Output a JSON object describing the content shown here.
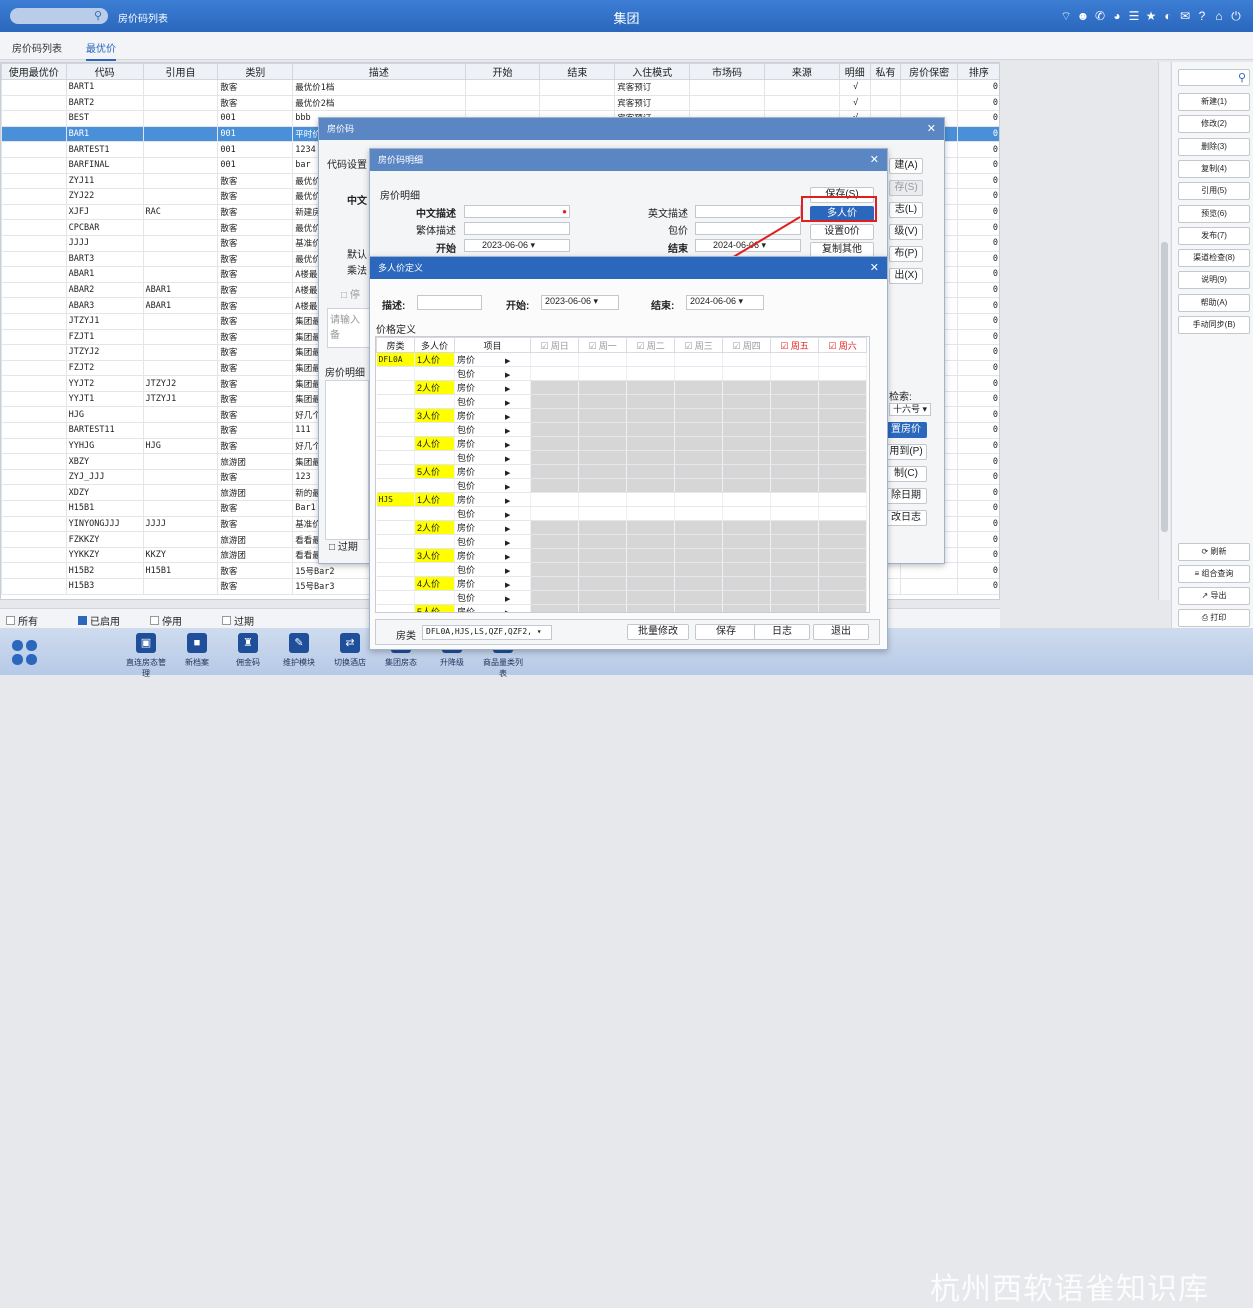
{
  "topbar": {
    "tab_title": "房价码列表",
    "center_title": "集团",
    "icons": [
      "wifi-icon",
      "face-icon",
      "phone-icon",
      "palette-icon",
      "list-icon",
      "star-icon",
      "moon-icon",
      "mail-icon",
      "help-icon",
      "home-icon",
      "power-icon"
    ]
  },
  "tabs": [
    "房价码列表",
    "最优价"
  ],
  "grid": {
    "headers": [
      "使用最优价",
      "代码",
      "引用自",
      "类别",
      "描述",
      "开始",
      "结束",
      "入住模式",
      "市场码",
      "来源",
      "明细",
      "私有",
      "房价保密",
      "排序"
    ],
    "rows": [
      [
        "",
        "BART1",
        "",
        "散客",
        "最优价1档",
        "",
        "",
        "宾客预订",
        "",
        "",
        "√",
        "",
        "",
        "0"
      ],
      [
        "",
        "BART2",
        "",
        "散客",
        "最优价2档",
        "",
        "",
        "宾客预订",
        "",
        "",
        "√",
        "",
        "",
        "0"
      ],
      [
        "",
        "BEST",
        "",
        "001",
        "bbb",
        "",
        "",
        "宾客预订",
        "",
        "",
        "√",
        "",
        "",
        "0"
      ],
      [
        "",
        "BAR1",
        "",
        "001",
        "平时价",
        "",
        "",
        "",
        "",
        "",
        "",
        "",
        "",
        "0"
      ],
      [
        "",
        "BARTEST1",
        "",
        "001",
        "1234",
        "",
        "",
        "",
        "",
        "",
        "",
        "",
        "",
        "0"
      ],
      [
        "",
        "BARFINAL",
        "",
        "001",
        "bar",
        "",
        "",
        "",
        "",
        "",
        "",
        "",
        "",
        "0"
      ],
      [
        "",
        "ZYJ11",
        "",
        "散客",
        "最优价",
        "",
        "",
        "",
        "",
        "",
        "",
        "",
        "",
        "0"
      ],
      [
        "",
        "ZYJ22",
        "",
        "散客",
        "最优价",
        "",
        "",
        "",
        "",
        "",
        "",
        "",
        "",
        "0"
      ],
      [
        "",
        "XJFJ",
        "RAC",
        "散客",
        "新建房",
        "",
        "",
        "",
        "",
        "",
        "",
        "",
        "",
        "0"
      ],
      [
        "",
        "CPCBAR",
        "",
        "散客",
        "最优价",
        "",
        "",
        "",
        "",
        "",
        "",
        "",
        "",
        "0"
      ],
      [
        "",
        "JJJJ",
        "",
        "散客",
        "基准价",
        "",
        "",
        "",
        "",
        "",
        "",
        "",
        "",
        "0"
      ],
      [
        "",
        "BART3",
        "",
        "散客",
        "最优价",
        "",
        "",
        "",
        "",
        "",
        "",
        "",
        "",
        "0"
      ],
      [
        "",
        "ABAR1",
        "",
        "散客",
        "A楼最",
        "",
        "",
        "",
        "",
        "",
        "",
        "",
        "",
        "0"
      ],
      [
        "",
        "ABAR2",
        "ABAR1",
        "散客",
        "A楼最",
        "",
        "",
        "",
        "",
        "",
        "",
        "",
        "",
        "0"
      ],
      [
        "",
        "ABAR3",
        "ABAR1",
        "散客",
        "A楼最",
        "",
        "",
        "",
        "",
        "",
        "",
        "",
        "",
        "0"
      ],
      [
        "",
        "JTZYJ1",
        "",
        "散客",
        "集团最",
        "",
        "",
        "",
        "",
        "",
        "",
        "",
        "",
        "0"
      ],
      [
        "",
        "FZJT1",
        "",
        "散客",
        "集团最",
        "",
        "",
        "",
        "",
        "",
        "",
        "",
        "",
        "0"
      ],
      [
        "",
        "JTZYJ2",
        "",
        "散客",
        "集团最",
        "",
        "",
        "",
        "",
        "",
        "",
        "",
        "",
        "0"
      ],
      [
        "",
        "FZJT2",
        "",
        "散客",
        "集团最",
        "",
        "",
        "",
        "",
        "",
        "",
        "",
        "",
        "0"
      ],
      [
        "",
        "YYJT2",
        "JTZYJ2",
        "散客",
        "集团最",
        "",
        "",
        "",
        "",
        "",
        "",
        "",
        "",
        "0"
      ],
      [
        "",
        "YYJT1",
        "JTZYJ1",
        "散客",
        "集团最",
        "",
        "",
        "",
        "",
        "",
        "",
        "",
        "",
        "0"
      ],
      [
        "",
        "HJG",
        "",
        "散客",
        "好几个",
        "",
        "",
        "",
        "",
        "",
        "",
        "",
        "",
        "0"
      ],
      [
        "",
        "BARTEST11",
        "",
        "散客",
        "111",
        "",
        "",
        "",
        "",
        "",
        "",
        "",
        "",
        "0"
      ],
      [
        "",
        "YYHJG",
        "HJG",
        "散客",
        "好几个",
        "",
        "",
        "",
        "",
        "",
        "",
        "",
        "",
        "0"
      ],
      [
        "",
        "XBZY",
        "",
        "旅游团",
        "集团最",
        "",
        "",
        "",
        "",
        "",
        "",
        "",
        "",
        "0"
      ],
      [
        "",
        "ZYJ_JJJ",
        "",
        "散客",
        "123",
        "",
        "",
        "",
        "",
        "",
        "",
        "",
        "",
        "0"
      ],
      [
        "",
        "XDZY",
        "",
        "旅游团",
        "新的最",
        "",
        "",
        "",
        "",
        "",
        "",
        "",
        "",
        "0"
      ],
      [
        "",
        "H15B1",
        "",
        "散客",
        "Bar1",
        "",
        "",
        "",
        "",
        "",
        "",
        "",
        "",
        "0"
      ],
      [
        "",
        "YINYONGJJJ",
        "JJJJ",
        "散客",
        "基准价",
        "",
        "",
        "",
        "",
        "",
        "",
        "",
        "",
        "0"
      ],
      [
        "",
        "FZKKZY",
        "",
        "旅游团",
        "看看最",
        "",
        "",
        "",
        "",
        "",
        "",
        "",
        "",
        "0"
      ],
      [
        "",
        "YYKKZY",
        "KKZY",
        "旅游团",
        "看看最",
        "",
        "",
        "",
        "",
        "",
        "",
        "",
        "",
        "0"
      ],
      [
        "",
        "H15B2",
        "H15B1",
        "散客",
        "15号Bar2",
        "",
        "",
        "",
        "",
        "",
        "",
        "",
        "",
        "0"
      ],
      [
        "",
        "H15B3",
        "",
        "散客",
        "15号Bar3",
        "",
        "",
        "",
        "",
        "",
        "",
        "",
        "",
        "0"
      ]
    ]
  },
  "filters": [
    {
      "label": "所有",
      "checked": false
    },
    {
      "label": "已启用",
      "checked": true
    },
    {
      "label": "停用",
      "checked": false
    },
    {
      "label": "过期",
      "checked": false
    }
  ],
  "right_panel": {
    "buttons": [
      "新建(1)",
      "修改(2)",
      "删除(3)",
      "复制(4)",
      "引用(5)",
      "预览(6)",
      "发布(7)",
      "渠道检查(8)",
      "说明(9)",
      "帮助(A)",
      "手动同步(B)"
    ],
    "bottom": [
      "⟳ 刷新",
      "≡ 组合查询",
      "↗ 导出",
      "⎙ 打印"
    ]
  },
  "taskbar": {
    "items": [
      "直连房态管理",
      "新档案",
      "佣金码",
      "维护模块",
      "切换酒店",
      "集团房态",
      "升降级",
      "商品量类列表"
    ],
    "watermark": "杭州西软语雀知识库"
  },
  "dialog1": {
    "title": "房价码",
    "section": "代码设置",
    "row_labels": [
      "中文",
      "默认",
      "乘法"
    ],
    "stop_label": "停",
    "placeholder": "请输入备",
    "detail_label": "房价明细",
    "expired": "过期",
    "buttons": [
      "建(A)",
      "存(S)",
      "志(L)",
      "级(V)",
      "布(P)",
      "出(X)"
    ],
    "lower_buttons": [
      "置房价",
      "用到(P)",
      "制(C)",
      "除日期",
      "改日志"
    ],
    "search_label": "检索:",
    "search_value": "十六号"
  },
  "dialog2": {
    "title": "房价码明细",
    "section": "房价明细",
    "cn_desc": "中文描述",
    "tw_desc": "繁体描述",
    "start": "开始",
    "start_value": "2023-06-06",
    "en_desc": "英文描述",
    "pkg": "包价",
    "end": "结束",
    "end_value": "2024-06-06",
    "buttons": [
      "保存(S)",
      "多人价",
      "设置0价",
      "复制其他"
    ]
  },
  "dialog3": {
    "title": "多人价定义",
    "desc_label": "描述:",
    "start_label": "开始:",
    "start_value": "2023-06-06",
    "end_label": "结束:",
    "end_value": "2024-06-06",
    "section": "价格定义",
    "columns": [
      "房类",
      "多人价",
      "项目",
      "周日",
      "周一",
      "周二",
      "周三",
      "周四",
      "周五",
      "周六"
    ],
    "room_types": [
      "DFL0A",
      "HJS"
    ],
    "persons": [
      "1人价",
      "2人价",
      "3人价",
      "4人价",
      "5人价"
    ],
    "items": [
      "房价",
      "包价"
    ],
    "footer": {
      "room_label": "房类",
      "room_value": "DFL0A,HJS,LS,QZF,QZF2,",
      "buttons": [
        "批量修改",
        "保存",
        "日志",
        "退出"
      ]
    }
  }
}
